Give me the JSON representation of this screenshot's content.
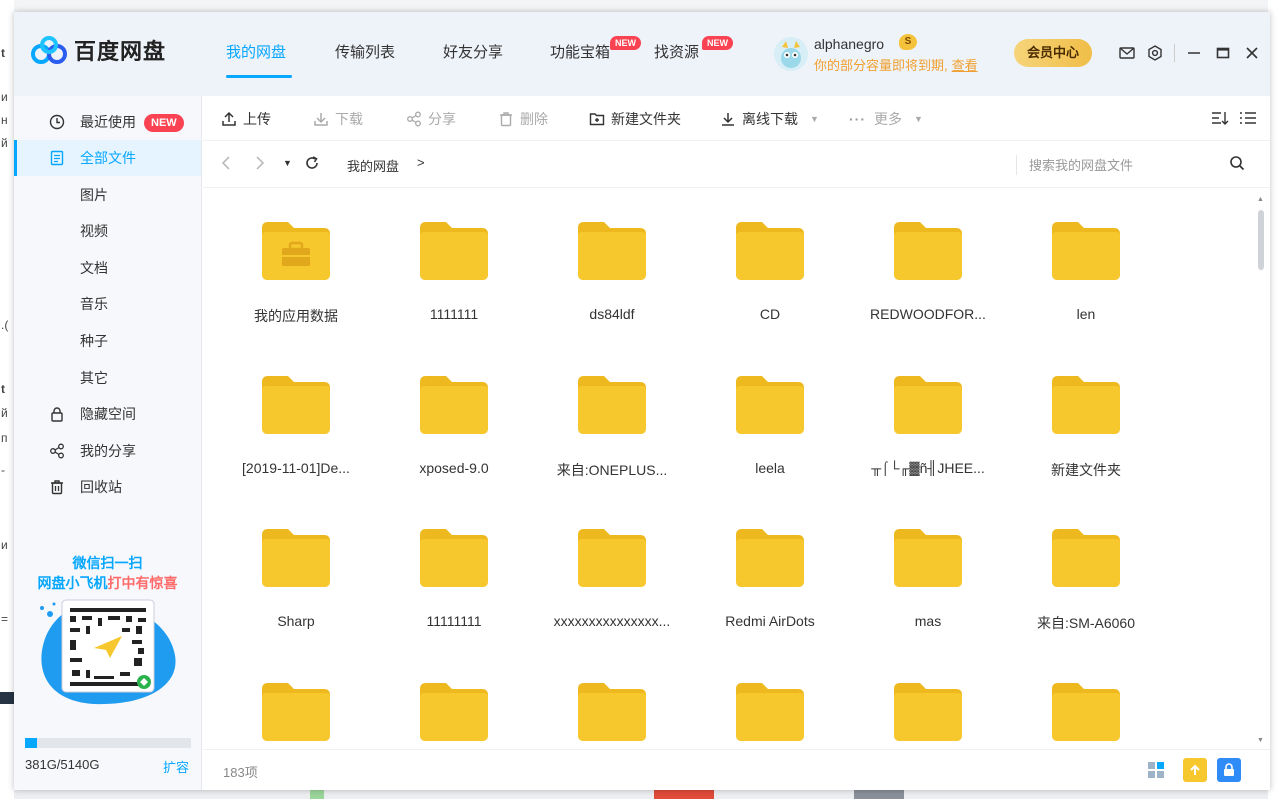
{
  "app": {
    "name": "百度网盘"
  },
  "nav": {
    "tabs": [
      {
        "label": "我的网盘",
        "active": true
      },
      {
        "label": "传输列表"
      },
      {
        "label": "好友分享"
      },
      {
        "label": "功能宝箱",
        "badge": "NEW"
      },
      {
        "label": "找资源",
        "badge": "NEW"
      }
    ]
  },
  "user": {
    "name": "alphanegro",
    "coin_badge": "S",
    "warning": "你的部分容量即将到期,",
    "warning_link": "查看",
    "vip_button": "会员中心"
  },
  "sidebar": {
    "items": [
      {
        "label": "最近使用",
        "icon": "clock-icon",
        "badge": "NEW"
      },
      {
        "label": "全部文件",
        "icon": "document-icon",
        "active": true
      },
      {
        "label": "图片"
      },
      {
        "label": "视频"
      },
      {
        "label": "文档"
      },
      {
        "label": "音乐"
      },
      {
        "label": "种子"
      },
      {
        "label": "其它"
      },
      {
        "label": "隐藏空间",
        "icon": "lock-icon"
      },
      {
        "label": "我的分享",
        "icon": "share-icon"
      },
      {
        "label": "回收站",
        "icon": "trash-icon"
      }
    ],
    "promo_line1": "微信扫一扫",
    "promo_line2_a": "网盘小飞机",
    "promo_line2_b": "打中有惊喜",
    "storage_text": "381G/5140G",
    "storage_used_fraction": 0.074,
    "expand": "扩容"
  },
  "toolbar": {
    "upload": "上传",
    "download": "下载",
    "share": "分享",
    "delete": "删除",
    "new_folder": "新建文件夹",
    "offline_download": "离线下载",
    "more": "更多"
  },
  "address": {
    "crumb": "我的网盘",
    "sep": ">",
    "search_placeholder": "搜索我的网盘文件"
  },
  "files": [
    {
      "name": "我的应用数据",
      "special": true
    },
    {
      "name": "1111111"
    },
    {
      "name": "ds84ldf"
    },
    {
      "name": "CD"
    },
    {
      "name": "REDWOODFOR..."
    },
    {
      "name": "len"
    },
    {
      "name": "[2019-11-01]De..."
    },
    {
      "name": "xposed-9.0"
    },
    {
      "name": "来自:ONEPLUS..."
    },
    {
      "name": "leela"
    },
    {
      "name": "╥⌠└╓▓ñ╢JHEE..."
    },
    {
      "name": "新建文件夹"
    },
    {
      "name": "Sharp"
    },
    {
      "name": "11111111"
    },
    {
      "name": "xxxxxxxxxxxxxxx..."
    },
    {
      "name": "Redmi AirDots"
    },
    {
      "name": "mas"
    },
    {
      "name": "来自:SM-A6060"
    },
    {
      "name": ""
    },
    {
      "name": ""
    },
    {
      "name": ""
    },
    {
      "name": ""
    },
    {
      "name": ""
    },
    {
      "name": ""
    }
  ],
  "status": {
    "count": "183项"
  },
  "colors": {
    "accent": "#06a7ff",
    "folder": "#f7c82d",
    "folder_tab": "#eeb91e",
    "badge": "#fa4352"
  }
}
